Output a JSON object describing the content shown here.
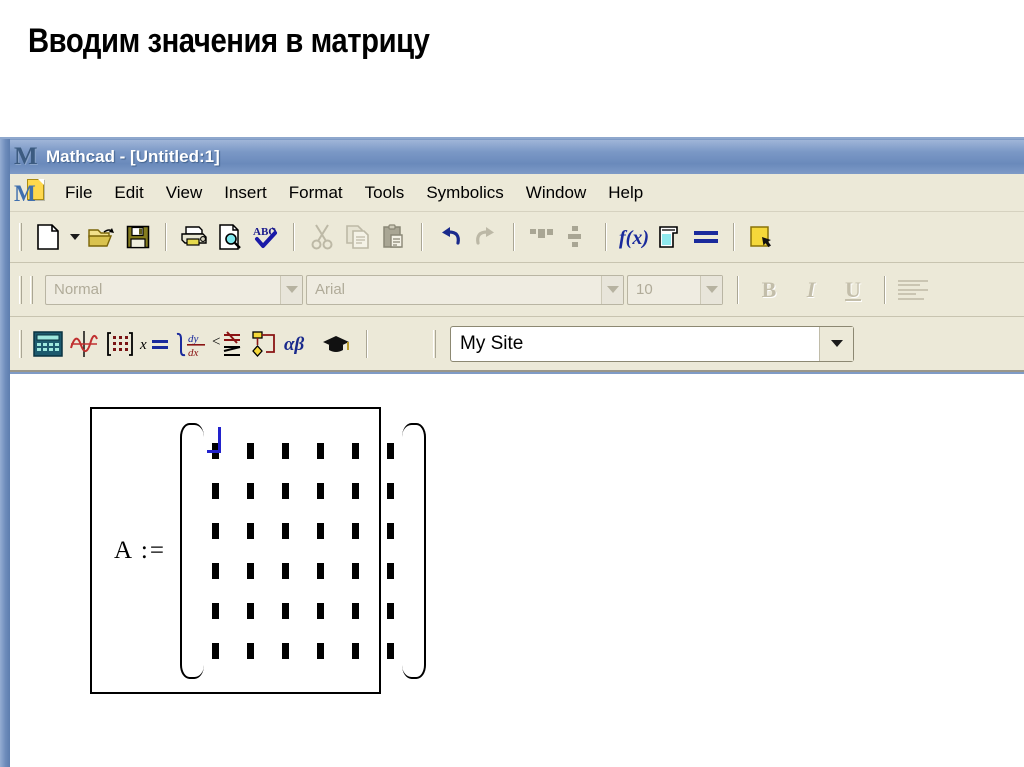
{
  "slide": {
    "title": "Вводим значения в матрицу"
  },
  "window": {
    "titlebar": {
      "logo_icon": "mathcad-m-logo-icon",
      "text": "Mathcad - [Untitled:1]"
    },
    "menubar": {
      "app_icon": "mathcad-document-icon",
      "items": [
        {
          "label": "File"
        },
        {
          "label": "Edit"
        },
        {
          "label": "View"
        },
        {
          "label": "Insert"
        },
        {
          "label": "Format"
        },
        {
          "label": "Tools"
        },
        {
          "label": "Symbolics"
        },
        {
          "label": "Window"
        },
        {
          "label": "Help"
        }
      ]
    },
    "toolbar_main": {
      "buttons": [
        {
          "name": "new-document-icon",
          "tip": "New"
        },
        {
          "name": "new-document-dropdown-icon",
          "tip": "New dropdown"
        },
        {
          "name": "open-folder-icon",
          "tip": "Open"
        },
        {
          "name": "save-icon",
          "tip": "Save"
        },
        {
          "name": "print-icon",
          "tip": "Print"
        },
        {
          "name": "print-preview-icon",
          "tip": "Print Preview"
        },
        {
          "name": "spell-check-icon",
          "tip": "Check Spelling"
        },
        {
          "name": "cut-icon",
          "tip": "Cut"
        },
        {
          "name": "copy-icon",
          "tip": "Copy"
        },
        {
          "name": "paste-icon",
          "tip": "Paste"
        },
        {
          "name": "undo-icon",
          "tip": "Undo"
        },
        {
          "name": "redo-icon",
          "tip": "Redo"
        },
        {
          "name": "align-across-icon",
          "tip": "Align Across"
        },
        {
          "name": "align-down-icon",
          "tip": "Align Down"
        },
        {
          "name": "insert-function-icon",
          "tip": "Insert Function"
        },
        {
          "name": "insert-unit-icon",
          "tip": "Insert Unit"
        },
        {
          "name": "calculate-icon",
          "tip": "Calculate"
        },
        {
          "name": "insert-hyperlink-icon",
          "tip": "Insert Hyperlink"
        }
      ]
    },
    "toolbar_format": {
      "style": {
        "value": "Normal",
        "placeholder": "Normal",
        "enabled": false
      },
      "font": {
        "value": "Arial",
        "placeholder": "Arial",
        "enabled": false
      },
      "size": {
        "value": "10",
        "placeholder": "10",
        "enabled": false
      },
      "bold_label": "B",
      "italic_label": "I",
      "underline_label": "U",
      "align_icon": "align-left-icon"
    },
    "toolbar_math": {
      "buttons": [
        {
          "name": "calculator-toolbar-icon",
          "tip": "Calculator Toolbar"
        },
        {
          "name": "graph-toolbar-icon",
          "tip": "Graph Toolbar"
        },
        {
          "name": "matrix-toolbar-icon",
          "tip": "Matrix Toolbar"
        },
        {
          "name": "evaluation-toolbar-icon",
          "tip": "Evaluation Toolbar"
        },
        {
          "name": "calculus-toolbar-icon",
          "tip": "Calculus Toolbar"
        },
        {
          "name": "boolean-toolbar-icon",
          "tip": "Boolean Toolbar"
        },
        {
          "name": "programming-toolbar-icon",
          "tip": "Programming Toolbar"
        },
        {
          "name": "greek-toolbar-icon",
          "tip": "Greek Symbol Toolbar"
        },
        {
          "name": "symbolic-toolbar-icon",
          "tip": "Symbolic Keyword Toolbar"
        }
      ],
      "site": {
        "value": "My Site",
        "placeholder": "My Site"
      }
    },
    "document": {
      "matrix_region": {
        "label": "A :=",
        "rows": 6,
        "cols": 6,
        "cells": [
          [
            "",
            "",
            "",
            "",
            "",
            ""
          ],
          [
            "",
            "",
            "",
            "",
            "",
            ""
          ],
          [
            "",
            "",
            "",
            "",
            "",
            ""
          ],
          [
            "",
            "",
            "",
            "",
            "",
            ""
          ],
          [
            "",
            "",
            "",
            "",
            "",
            ""
          ],
          [
            "",
            "",
            "",
            "",
            "",
            ""
          ]
        ],
        "cursor_cell": {
          "row": 0,
          "col": 0
        },
        "cursor_color": "#2222cc"
      }
    }
  },
  "colors": {
    "titlebar_gradient_top": "#9fb5d8",
    "titlebar_gradient_bottom": "#6a8abb",
    "chrome": "#ece9d8",
    "frame": "#6e8cbb",
    "text": "#000000",
    "document_bg": "#ffffff",
    "disabled_text": "#b0ab99"
  }
}
